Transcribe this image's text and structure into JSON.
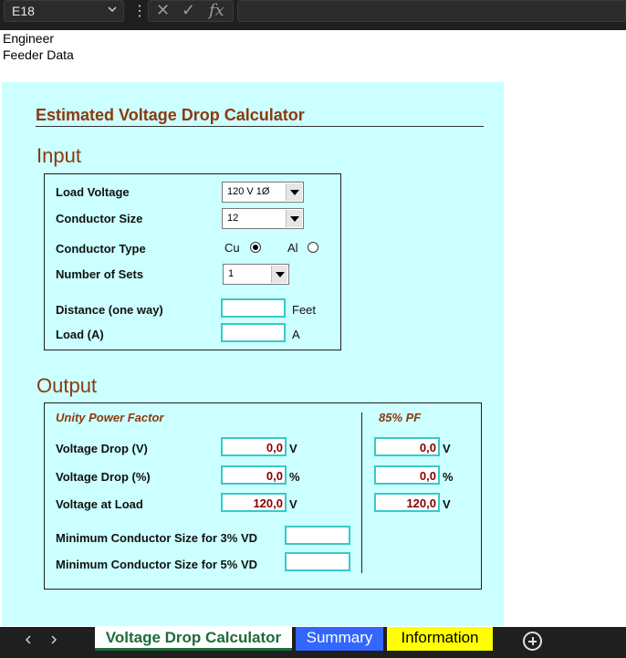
{
  "formula_bar": {
    "name_box": "E18",
    "name_box_dropdown_icon": "chevron-down-icon",
    "more_icon": "vertical-ellipsis-icon",
    "cancel_icon": "✕",
    "enter_icon": "✓",
    "function_icon": "fx",
    "formula": ""
  },
  "sheet": {
    "row1": "Engineer",
    "row2": "Feeder Data"
  },
  "calculator": {
    "title": "Estimated Voltage Drop Calculator",
    "input": {
      "heading": "Input",
      "load_voltage_label": "Load Voltage",
      "load_voltage_value": "120 V 1Ø",
      "conductor_size_label": "Conductor Size",
      "conductor_size_value": "12",
      "conductor_type_label": "Conductor Type",
      "cu_label": "Cu",
      "al_label": "Al",
      "selected_conductor": "Cu",
      "sets_label": "Number of Sets",
      "sets_value": "1",
      "distance_label": "Distance (one way)",
      "distance_value": "",
      "distance_unit": "Feet",
      "load_label": "Load (A)",
      "load_value": "",
      "load_unit": "A"
    },
    "output": {
      "heading": "Output",
      "unity_header": "Unity Power Factor",
      "pf85_header": "85% PF",
      "vd_label": "Voltage Drop (V)",
      "vd_pct_label": "Voltage Drop (%)",
      "vload_label": "Voltage at Load",
      "unity_vd": "0,0",
      "unity_vd_pct": "0,0",
      "unity_vload": "120,0",
      "pf85_vd": "0,0",
      "pf85_vd_pct": "0,0",
      "pf85_vload": "120,0",
      "unit_v": "V",
      "unit_pct": "%",
      "min3_label": "Minimum Conductor Size for 3% VD",
      "min3_value": "",
      "min5_label": "Minimum Conductor Size for 5% VD",
      "min5_value": ""
    }
  },
  "tabs": {
    "prev_icon": "◀",
    "next_icon": "▶",
    "active": "Voltage Drop Calculator",
    "summary": "Summary",
    "information": "Information",
    "active_color": "#1d6b3a",
    "summary_color": "#3366ff",
    "information_color": "#ffff00",
    "add_icon": "plus-circle-icon"
  }
}
